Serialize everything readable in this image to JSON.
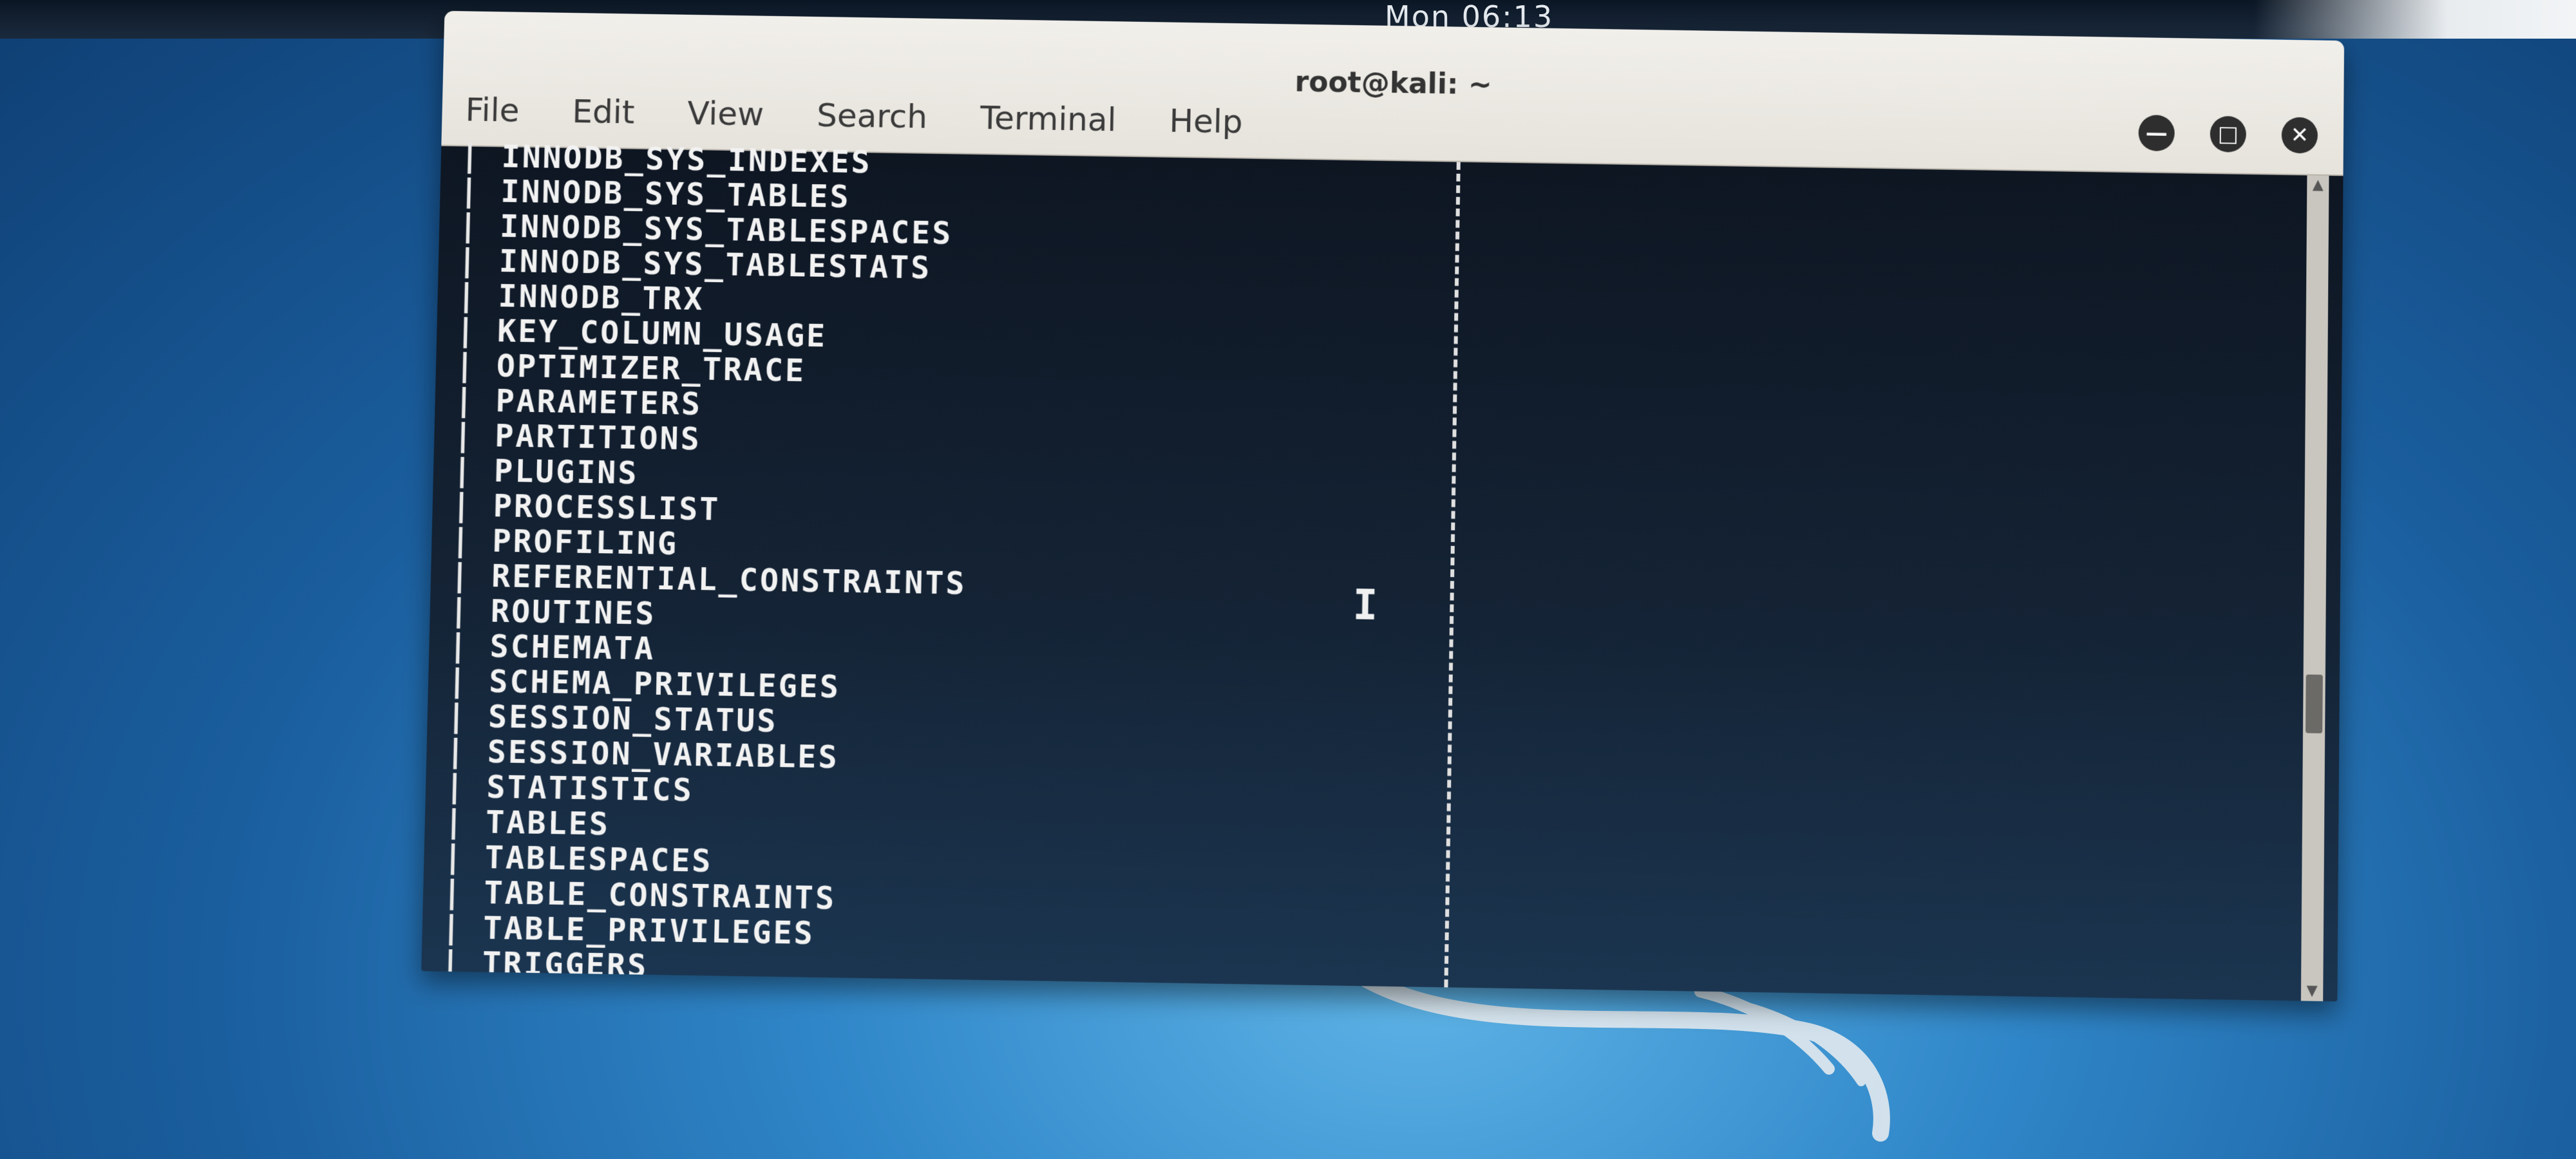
{
  "clock": "Mon 06:13",
  "window": {
    "title": "root@kali: ~",
    "controls": {
      "minimize": "—",
      "maximize": "□",
      "close": "✕"
    }
  },
  "menu": [
    "File",
    "Edit",
    "View",
    "Search",
    "Terminal",
    "Help"
  ],
  "terminal": {
    "lines": [
      "INNODB_SYS_INDEXES",
      "INNODB_SYS_TABLES",
      "INNODB_SYS_TABLESPACES",
      "INNODB_SYS_TABLESTATS",
      "INNODB_TRX",
      "KEY_COLUMN_USAGE",
      "OPTIMIZER_TRACE",
      "PARAMETERS",
      "PARTITIONS",
      "PLUGINS",
      "PROCESSLIST",
      "PROFILING",
      "REFERENTIAL_CONSTRAINTS",
      "ROUTINES",
      "SCHEMATA",
      "SCHEMA_PRIVILEGES",
      "SESSION_STATUS",
      "SESSION_VARIABLES",
      "STATISTICS",
      "TABLES",
      "TABLESPACES",
      "TABLE_CONSTRAINTS",
      "TABLE_PRIVILEGES",
      "TRIGGERS"
    ],
    "row_prefix": "| ",
    "background_color": "#0e1622",
    "text_color": "#f2f2f2"
  },
  "icons": {
    "minimize": "minimize-icon",
    "maximize": "maximize-icon",
    "close": "close-icon",
    "text_cursor": "text-cursor-icon"
  }
}
